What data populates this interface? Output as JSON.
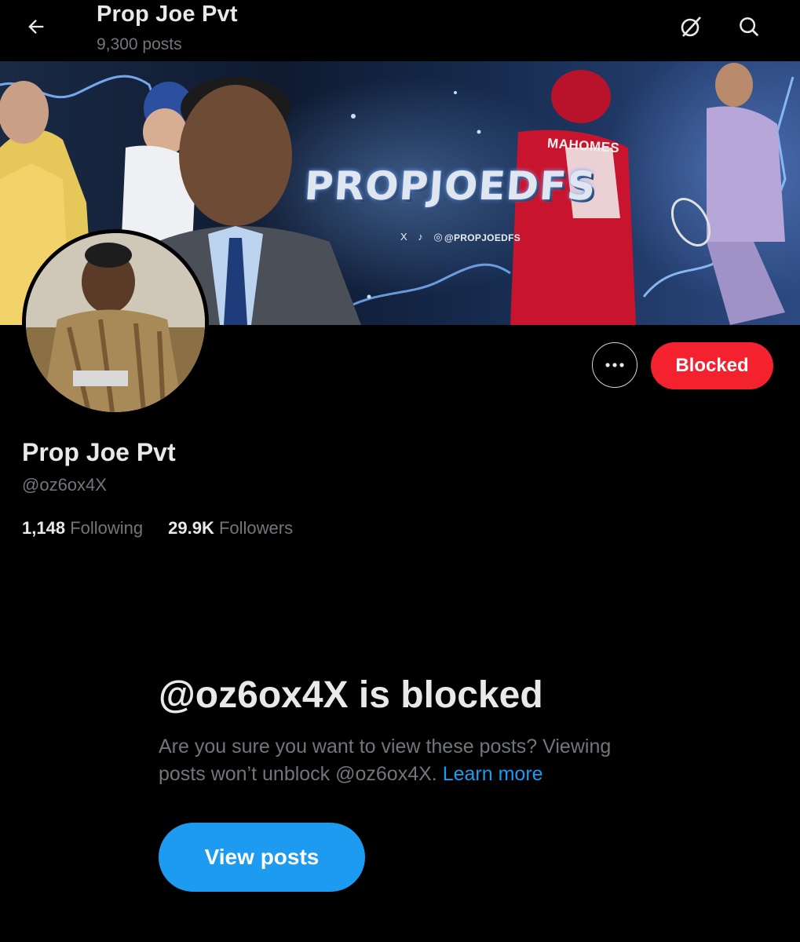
{
  "header": {
    "title": "Prop Joe Pvt",
    "posts_count": "9,300 posts"
  },
  "banner": {
    "title": "PROPJOEDFS",
    "handle": "@PROPJOEDFS",
    "socials": "X ♪ ◎",
    "jersey_name": "MAHOMES"
  },
  "actions": {
    "blocked_label": "Blocked"
  },
  "profile": {
    "name": "Prop Joe Pvt",
    "handle": "@oz6ox4X",
    "following_count": "1,148",
    "following_label": "Following",
    "followers_count": "29.9K",
    "followers_label": "Followers"
  },
  "blocked_notice": {
    "title": "@oz6ox4X is blocked",
    "description": "Are you sure you want to view these posts? Viewing posts won’t unblock @oz6ox4X.",
    "learn_more": "Learn more",
    "view_posts_label": "View posts"
  },
  "colors": {
    "background": "#000000",
    "text_primary": "#e7e9ea",
    "text_secondary": "#71767b",
    "blocked_red": "#f4212e",
    "accent_blue": "#1d9bf0"
  },
  "icons": [
    "arrow-left-icon",
    "grok-icon",
    "search-icon",
    "more-horizontal-icon"
  ]
}
